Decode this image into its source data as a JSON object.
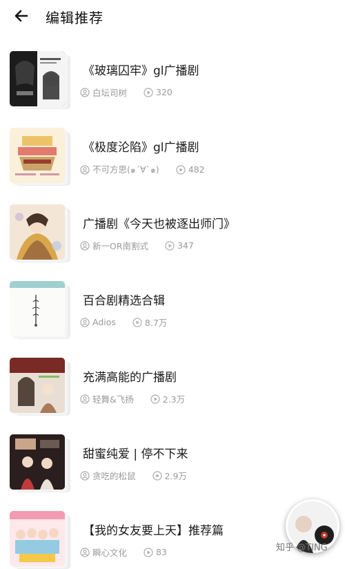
{
  "header": {
    "title": "编辑推荐"
  },
  "items": [
    {
      "title": "《玻璃囚牢》gl广播剧",
      "author": "白坛司树",
      "plays": "320"
    },
    {
      "title": "《极度沦陷》gl广播剧",
      "author": "不可方思(๑´∀`๑)",
      "plays": "482"
    },
    {
      "title": "广播剧《今天也被逐出师门》",
      "author": "新一OR南割式",
      "plays": "347"
    },
    {
      "title": "百合剧精选合辑",
      "author": "Adios",
      "plays": "8.7万"
    },
    {
      "title": "充满高能的广播剧",
      "author": "轻舞&飞扬",
      "plays": "2.3万"
    },
    {
      "title": "甜蜜纯爱 | 停不下来",
      "author": "贪吃的松鼠",
      "plays": "2.9万"
    },
    {
      "title": "【我的女友要上天】推荐篇",
      "author": "瞬心文化",
      "plays": "83"
    }
  ],
  "watermark": "知乎 @TING",
  "colors": {
    "meta": "#9a9a9a",
    "title": "#1a1a1a"
  },
  "icons": {
    "back": "arrow-left-icon",
    "author": "user-circle-icon",
    "plays": "play-circle-icon"
  }
}
